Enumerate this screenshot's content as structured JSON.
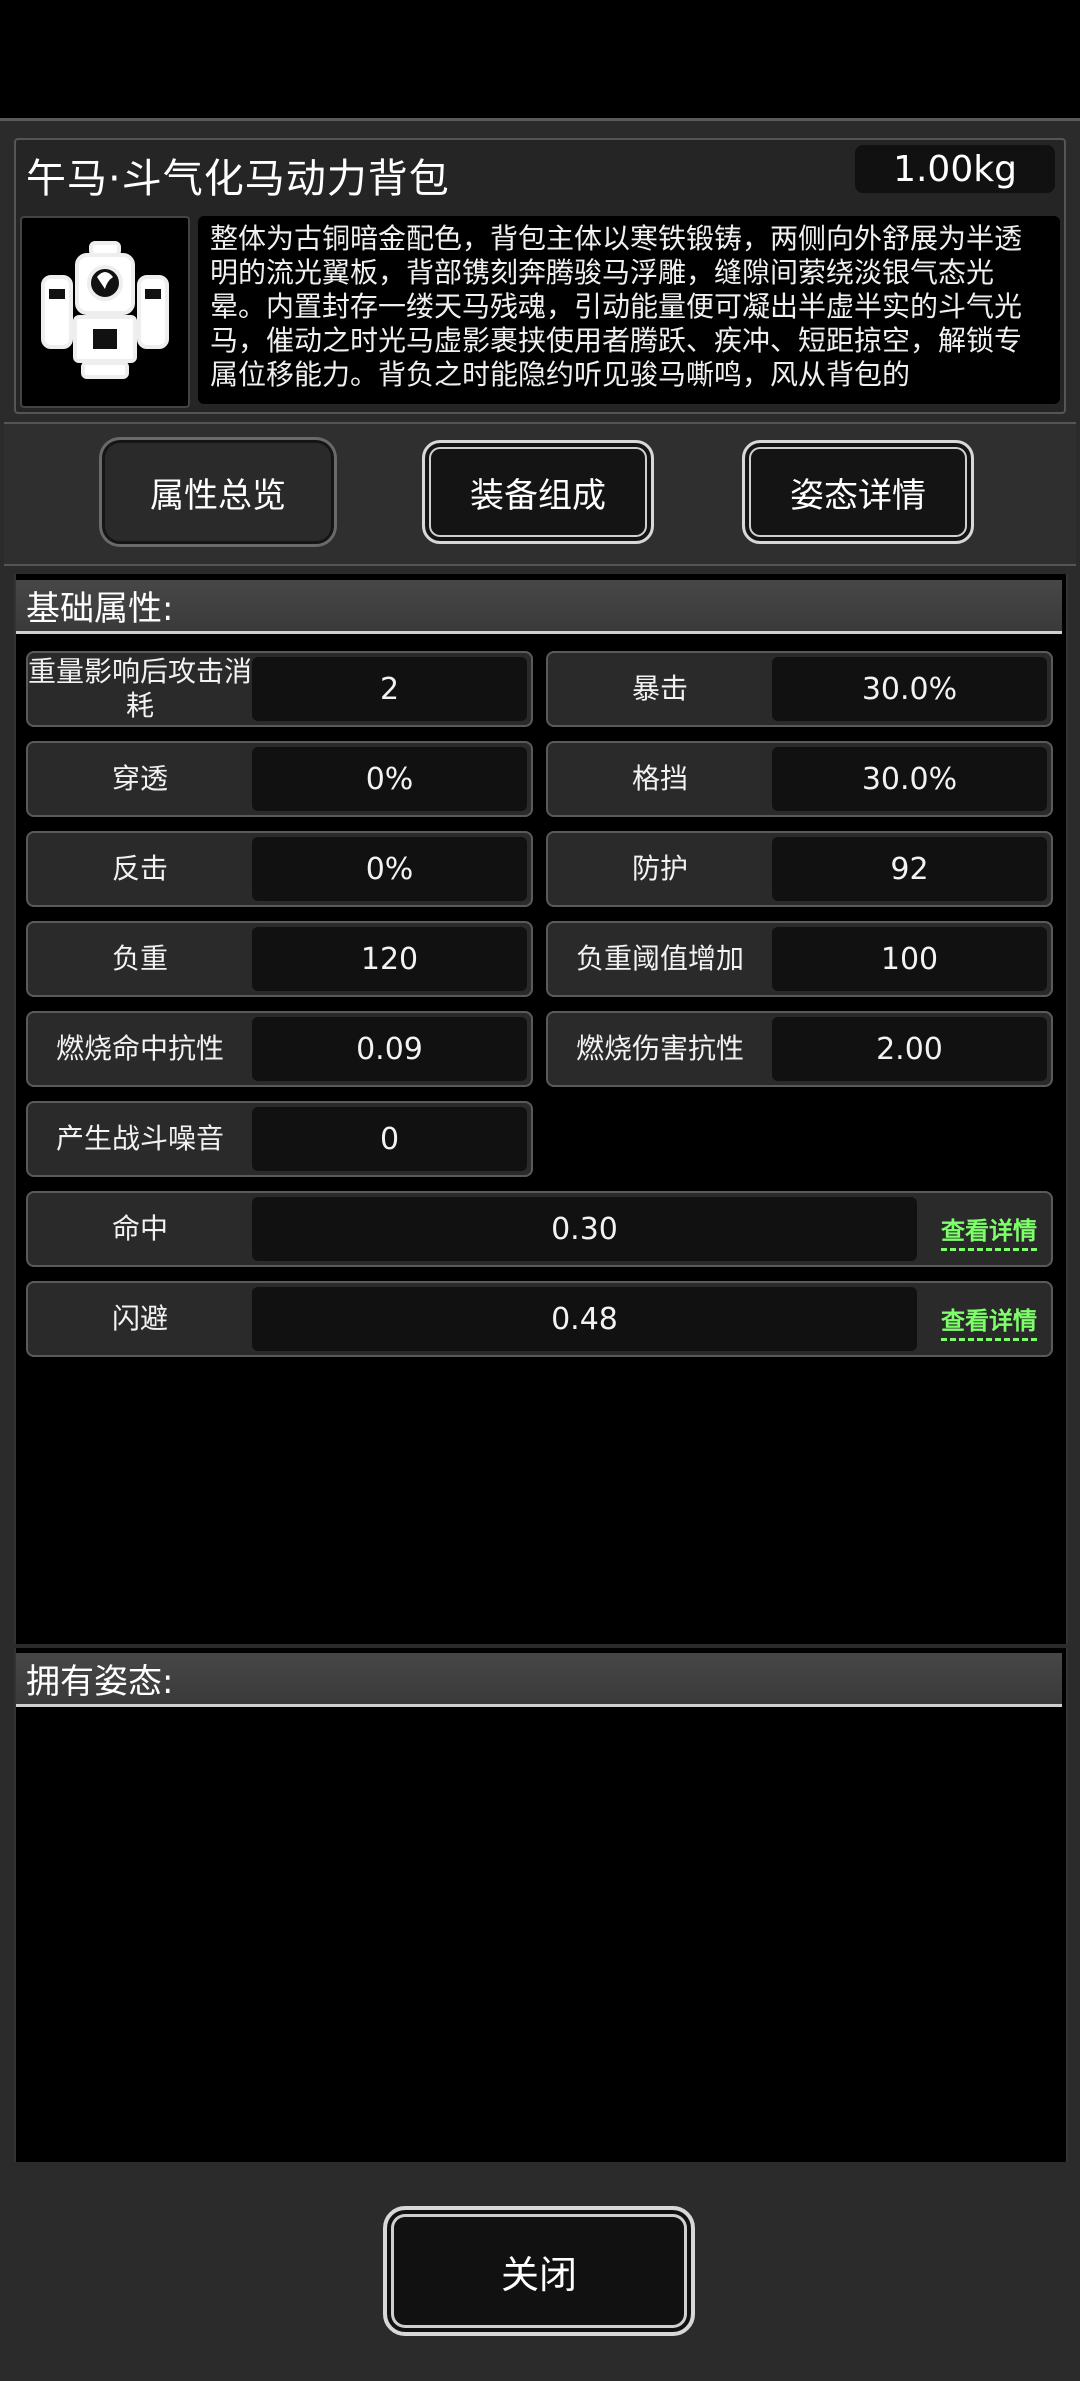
{
  "item": {
    "name": "午马·斗气化马动力背包",
    "weight": "1.00kg",
    "image_icon": "mech-backpack-icon",
    "description": "整体为古铜暗金配色，背包主体以寒铁锻铸，两侧向外舒展为半透明的流光翼板，背部镌刻奔腾骏马浮雕，缝隙间萦绕淡银气态光晕。内置封存一缕天马残魂，引动能量便可凝出半虚半实的斗气光马，催动之时光马虚影裹挟使用者腾跃、疾冲、短距掠空，解锁专属位移能力。背负之时能隐约听见骏马嘶鸣，风从背包的"
  },
  "tabs": [
    {
      "label": "属性总览"
    },
    {
      "label": "装备组成"
    },
    {
      "label": "姿态详情"
    }
  ],
  "base_section": {
    "title": "基础属性:",
    "stats": [
      {
        "label": "重量影响后攻击消耗",
        "value": "2"
      },
      {
        "label": "暴击",
        "value": "30.0%"
      },
      {
        "label": "穿透",
        "value": "0%"
      },
      {
        "label": "格挡",
        "value": "30.0%"
      },
      {
        "label": "反击",
        "value": "0%"
      },
      {
        "label": "防护",
        "value": "92"
      },
      {
        "label": "负重",
        "value": "120"
      },
      {
        "label": "负重阈值增加",
        "value": "100"
      },
      {
        "label": "燃烧命中抗性",
        "value": "0.09"
      },
      {
        "label": "燃烧伤害抗性",
        "value": "2.00"
      },
      {
        "label": "产生战斗噪音",
        "value": "0"
      }
    ],
    "wide_stats": [
      {
        "label": "命中",
        "value": "0.30",
        "detail": "查看详情"
      },
      {
        "label": "闪避",
        "value": "0.48",
        "detail": "查看详情"
      }
    ]
  },
  "stance_section": {
    "title": "拥有姿态:"
  },
  "close_label": "关闭",
  "colors": {
    "background": "#000000",
    "panel": "#2b2b2b",
    "detail_link": "#7dff6a"
  }
}
